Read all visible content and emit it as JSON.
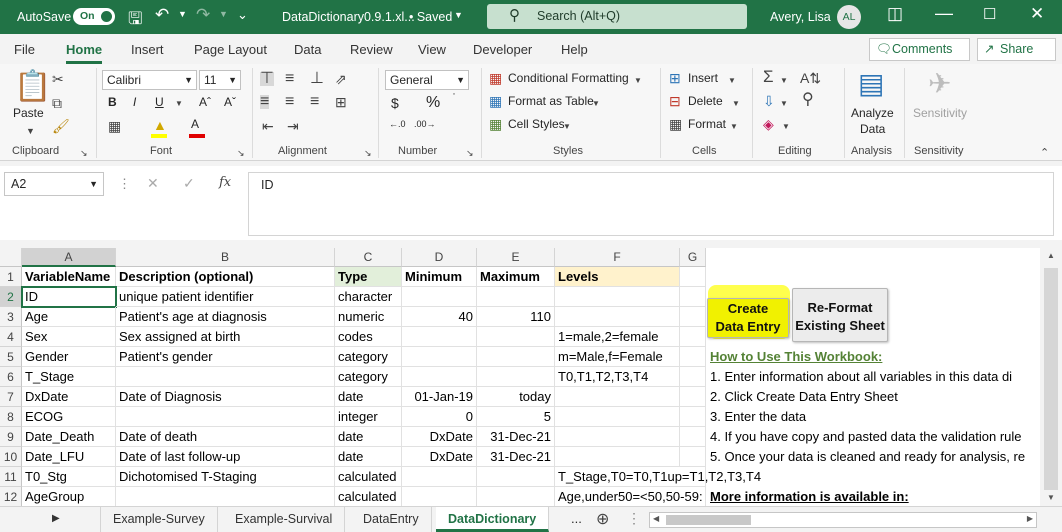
{
  "titlebar": {
    "autosave_label": "AutoSave",
    "autosave_state": "On",
    "filename": "DataDictionary0.9.1.xl...",
    "saved_status": "• Saved",
    "search_placeholder": "Search (Alt+Q)",
    "user_name": "Avery, Lisa",
    "user_initials": "AL"
  },
  "menu": {
    "tabs": [
      "File",
      "Home",
      "Insert",
      "Page Layout",
      "Data",
      "Review",
      "View",
      "Developer",
      "Help"
    ],
    "active": "Home",
    "comments_label": "Comments",
    "share_label": "Share"
  },
  "ribbon": {
    "clipboard": {
      "paste": "Paste",
      "group": "Clipboard"
    },
    "font": {
      "name": "Calibri",
      "size": "11",
      "group": "Font"
    },
    "alignment": {
      "group": "Alignment"
    },
    "number": {
      "format": "General",
      "group": "Number"
    },
    "styles": {
      "conditional": "Conditional Formatting",
      "format_table": "Format as Table",
      "cell_styles": "Cell Styles",
      "group": "Styles"
    },
    "cells": {
      "insert": "Insert",
      "delete": "Delete",
      "format": "Format",
      "group": "Cells"
    },
    "editing": {
      "group": "Editing"
    },
    "analysis": {
      "analyze_line1": "Analyze",
      "analyze_line2": "Data",
      "group": "Analysis"
    },
    "sensitivity": {
      "label": "Sensitivity",
      "group": "Sensitivity"
    }
  },
  "formula_bar": {
    "name_box": "A2",
    "value": "ID"
  },
  "columns": [
    "A",
    "B",
    "C",
    "D",
    "E",
    "F",
    "G"
  ],
  "rows": [
    "1",
    "2",
    "3",
    "4",
    "5",
    "6",
    "7",
    "8",
    "9",
    "10",
    "11",
    "12"
  ],
  "headers": {
    "A": "VariableName",
    "B": "Description (optional)",
    "C": "Type",
    "D": "Minimum",
    "E": "Maximum",
    "F": "Levels"
  },
  "data_rows": [
    {
      "A": "ID",
      "B": "unique patient identifier",
      "C": "character",
      "D": "",
      "E": "",
      "F": ""
    },
    {
      "A": "Age",
      "B": "Patient's age at diagnosis",
      "C": "numeric",
      "D": "40",
      "E": "110",
      "F": ""
    },
    {
      "A": "Sex",
      "B": "Sex assigned at birth",
      "C": "codes",
      "D": "",
      "E": "",
      "F": "1=male,2=female"
    },
    {
      "A": "Gender",
      "B": "Patient's gender",
      "C": "category",
      "D": "",
      "E": "",
      "F": "m=Male,f=Female"
    },
    {
      "A": "T_Stage",
      "B": "",
      "C": "category",
      "D": "",
      "E": "",
      "F": "T0,T1,T2,T3,T4"
    },
    {
      "A": "DxDate",
      "B": "Date of Diagnosis",
      "C": "date",
      "D": "01-Jan-19",
      "E": "today",
      "F": ""
    },
    {
      "A": "ECOG",
      "B": "",
      "C": "integer",
      "D": "0",
      "E": "5",
      "F": ""
    },
    {
      "A": "Date_Death",
      "B": "Date of death",
      "C": "date",
      "D": "DxDate",
      "E": "31-Dec-21",
      "F": ""
    },
    {
      "A": "Date_LFU",
      "B": "Date of last follow-up",
      "C": "date",
      "D": "DxDate",
      "E": "31-Dec-21",
      "F": ""
    },
    {
      "A": "T0_Stg",
      "B": "Dichotomised T-Staging",
      "C": "calculated",
      "D": "",
      "E": "",
      "F": "T_Stage,T0=T0,T1up=T1,T2,T3,T4"
    },
    {
      "A": "AgeGroup",
      "B": "",
      "C": "calculated",
      "D": "",
      "E": "",
      "F": "Age,under50=<50,50-59:"
    }
  ],
  "buttons": {
    "create_line1": "Create",
    "create_line2": "Data Entry",
    "reformat_line1": "Re-Format",
    "reformat_line2": "Existing Sheet"
  },
  "instructions": {
    "title": "How to Use This Workbook:",
    "steps": [
      "1. Enter information about all variables in this data di",
      "2. Click Create Data Entry Sheet",
      "3. Enter the data",
      "4. If you have copy and pasted data the validation rule",
      "5. Once your data is cleaned and ready for analysis, re"
    ],
    "more_info": "More information is available in:"
  },
  "sheet_tabs": {
    "tabs": [
      "Example-Survey",
      "Example-Survival",
      "DataEntry",
      "DataDictionary"
    ],
    "active": "DataDictionary",
    "more": "..."
  },
  "colors": {
    "excel_green": "#217346",
    "highlight": "#ffff3a",
    "type_fill": "#e2efda",
    "levels_fill": "#fff2cc",
    "link_green": "#548235"
  }
}
